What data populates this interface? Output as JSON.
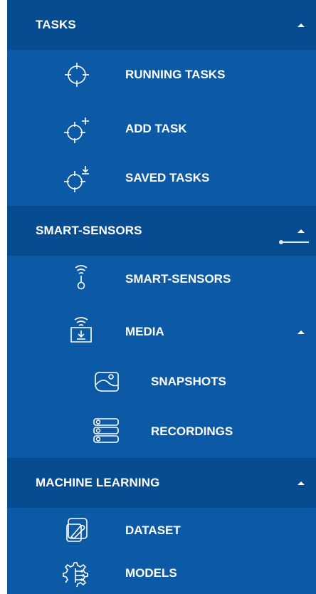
{
  "sidebar": {
    "sections": [
      {
        "label": "TASKS",
        "items": [
          {
            "label": "RUNNING TASKS",
            "icon": "crosshair-icon"
          },
          {
            "label": "ADD TASK",
            "icon": "crosshair-plus-icon"
          },
          {
            "label": "SAVED TASKS",
            "icon": "crosshair-download-icon"
          }
        ]
      },
      {
        "label": "SMART-SENSORS",
        "items": [
          {
            "label": "SMART-SENSORS",
            "icon": "sensor-icon"
          },
          {
            "label": "MEDIA",
            "icon": "media-download-icon"
          },
          {
            "label": "SNAPSHOTS",
            "icon": "snapshot-icon"
          },
          {
            "label": "RECORDINGS",
            "icon": "recordings-icon"
          }
        ]
      },
      {
        "label": "MACHINE LEARNING",
        "items": [
          {
            "label": "DATASET",
            "icon": "dataset-icon"
          },
          {
            "label": "MODELS",
            "icon": "models-icon"
          }
        ]
      }
    ]
  },
  "colors": {
    "sidebar_bg": "#0c5aa6",
    "section_header_bg": "#074c91",
    "text": "#ffffff"
  }
}
